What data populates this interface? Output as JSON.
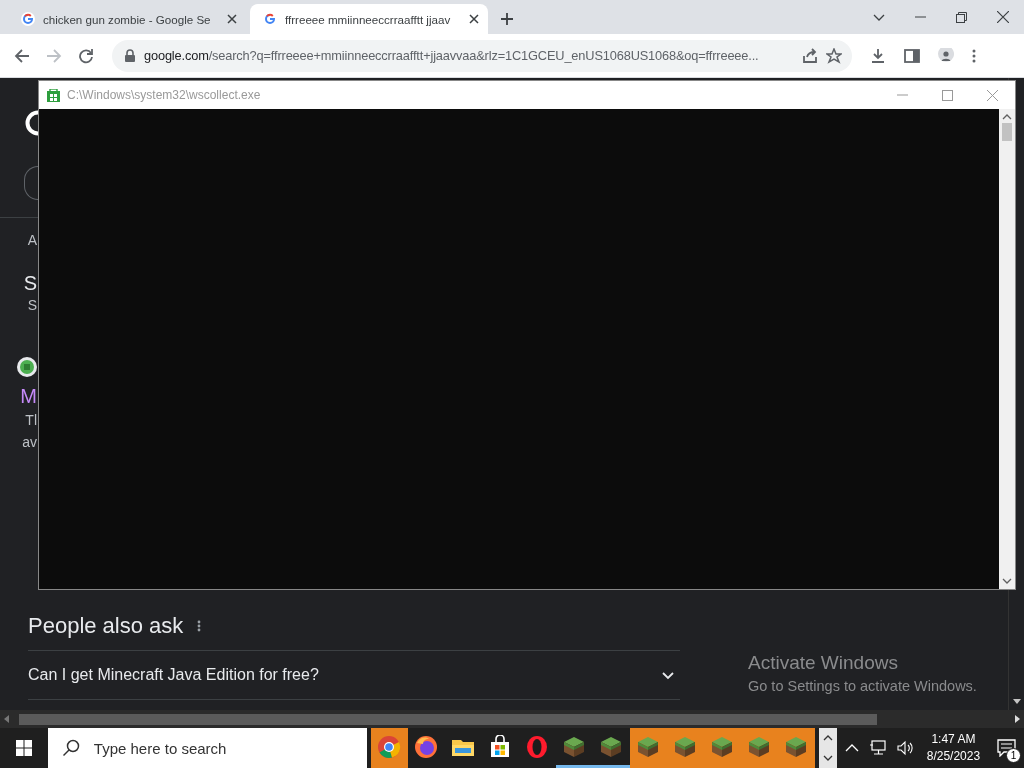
{
  "browser": {
    "tabs": [
      {
        "title": "chicken gun zombie - Google Se",
        "selected": false
      },
      {
        "title": "ffrreeee mmiinneeccrraafftt jjaav",
        "selected": true
      }
    ],
    "url_host": "google.com",
    "url_rest": "/search?q=ffrreeee+mmiinneeccrraafftt+jjaavvaa&rlz=1C1GCEU_enUS1068US1068&oq=ffrreeee..."
  },
  "page": {
    "cut_texts": [
      {
        "kind": "small",
        "text": "A"
      },
      {
        "kind": "heading",
        "text": "S"
      },
      {
        "kind": "small",
        "text": "S"
      },
      {
        "kind": "favicon"
      },
      {
        "kind": "link",
        "text": "M"
      },
      {
        "kind": "body",
        "text": "Tl"
      },
      {
        "kind": "body",
        "text": "av"
      }
    ],
    "people_also_ask": {
      "heading": "People also ask",
      "questions": [
        {
          "text": "Can I get Minecraft Java Edition for free?",
          "expanded": false
        }
      ]
    }
  },
  "console": {
    "title": "C:\\Windows\\system32\\wscollect.exe"
  },
  "activation": {
    "title": "Activate Windows",
    "subtitle": "Go to Settings to activate Windows."
  },
  "taskbar": {
    "search_placeholder": "Type here to search",
    "apps": [
      {
        "kind": "chrome",
        "flashing": true,
        "running": false
      },
      {
        "kind": "firefox",
        "flashing": false,
        "running": false
      },
      {
        "kind": "files",
        "flashing": false,
        "running": false
      },
      {
        "kind": "store",
        "flashing": false,
        "running": false
      },
      {
        "kind": "opera",
        "flashing": false,
        "running": false
      },
      {
        "kind": "block",
        "flashing": false,
        "running": true
      },
      {
        "kind": "block",
        "flashing": false,
        "running": true
      },
      {
        "kind": "block",
        "flashing": true,
        "running": false
      },
      {
        "kind": "block",
        "flashing": true,
        "running": false
      },
      {
        "kind": "block",
        "flashing": true,
        "running": false
      },
      {
        "kind": "block",
        "flashing": true,
        "running": false
      },
      {
        "kind": "block",
        "flashing": true,
        "running": false
      }
    ],
    "time": "1:47 AM",
    "date": "8/25/2023",
    "notification_count": "1"
  }
}
